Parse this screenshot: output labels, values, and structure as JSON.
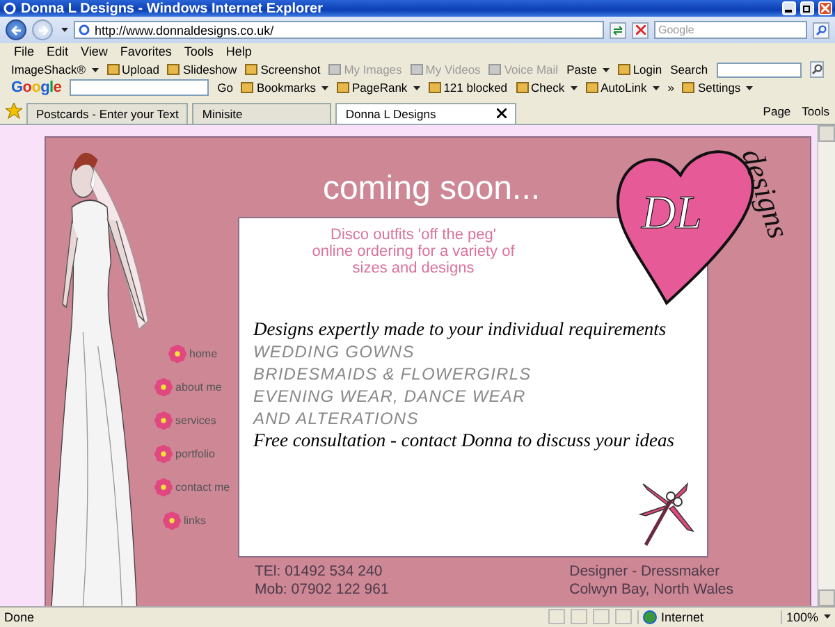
{
  "window": {
    "title": "Donna L Designs - Windows Internet Explorer"
  },
  "address_bar": {
    "url": "http://www.donnaldesigns.co.uk/"
  },
  "search_box": {
    "placeholder": "Google"
  },
  "menu_bar": [
    "File",
    "Edit",
    "View",
    "Favorites",
    "Tools",
    "Help"
  ],
  "toolbar_1": [
    {
      "label": "ImageShack®",
      "kind": "dropdown",
      "disabled": false
    },
    {
      "label": "Upload",
      "kind": "button",
      "disabled": false
    },
    {
      "label": "Slideshow",
      "kind": "button",
      "disabled": false
    },
    {
      "label": "Screenshot",
      "kind": "button",
      "disabled": false
    },
    {
      "label": "My Images",
      "kind": "button",
      "disabled": true
    },
    {
      "label": "My Videos",
      "kind": "button",
      "disabled": true
    },
    {
      "label": "Voice Mail",
      "kind": "button",
      "disabled": true
    },
    {
      "label": "Paste",
      "kind": "dropdown",
      "disabled": false
    },
    {
      "label": "Login",
      "kind": "button",
      "disabled": false
    }
  ],
  "toolbar_search_label": "Search",
  "google_logo": "Google",
  "toolbar_2": [
    {
      "label": "Go",
      "kind": "text"
    },
    {
      "label": "Bookmarks",
      "kind": "dropdown"
    },
    {
      "label": "PageRank",
      "kind": "dropdown"
    },
    {
      "label": "121 blocked",
      "kind": "button"
    },
    {
      "label": "Check",
      "kind": "dropdown"
    },
    {
      "label": "AutoLink",
      "kind": "dropdown"
    },
    {
      "label": "»",
      "kind": "text"
    },
    {
      "label": "Settings",
      "kind": "dropdown"
    }
  ],
  "tabs": [
    {
      "label": "Postcards - Enter your Text",
      "selected": false
    },
    {
      "label": "Minisite",
      "selected": false
    },
    {
      "label": "Donna L Designs",
      "selected": true
    }
  ],
  "command_bar": [
    "Page",
    "Tools"
  ],
  "site": {
    "heading": "coming soon...",
    "subtitle": [
      "Disco outfits 'off the peg'",
      "online ordering for a variety of",
      "sizes and designs"
    ],
    "logo_initials": "DL",
    "logo_word": "designs",
    "intro": "Designs expertly made to your individual requirements",
    "services": [
      "WEDDING GOWNS",
      "BRIDESMAIDS & FLOWERGIRLS",
      "EVENING WEAR, DANCE WEAR",
      "AND ALTERATIONS"
    ],
    "closing": "Free consultation - contact Donna to discuss your ideas",
    "nav": [
      "home",
      "about me",
      "services",
      "portfolio",
      "contact me",
      "links"
    ],
    "contact_left": [
      "TEl: 01492 534 240",
      "Mob: 07902 122 961"
    ],
    "contact_right": [
      "Designer - Dressmaker",
      "Colwyn Bay, North Wales"
    ]
  },
  "status_bar": {
    "text": "Done",
    "zone": "Internet",
    "zoom": "100%"
  }
}
